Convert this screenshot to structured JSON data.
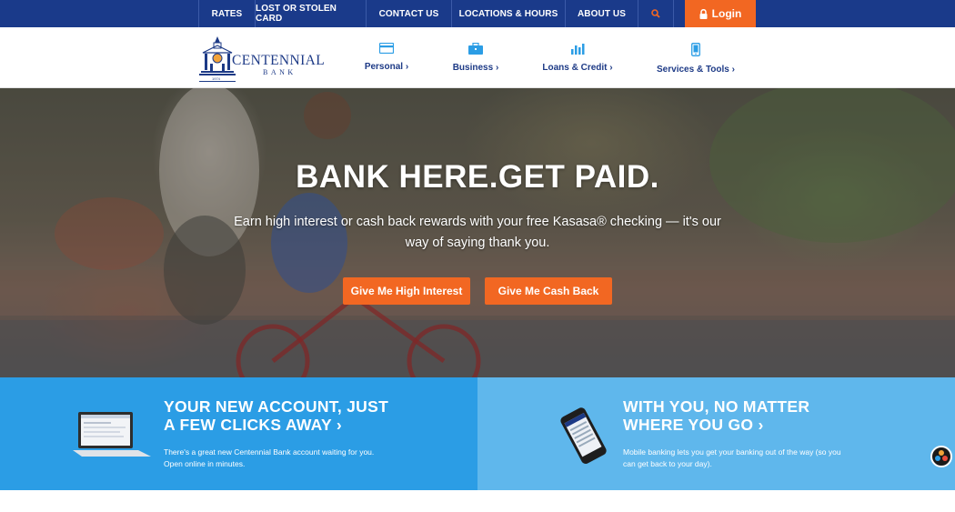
{
  "topbar": {
    "links": [
      "RATES",
      "LOST OR STOLEN CARD",
      "CONTACT US",
      "LOCATIONS & HOURS",
      "ABOUT US"
    ],
    "search_icon": "search-icon",
    "login_label": "Login",
    "login_icon": "lock-icon"
  },
  "logo": {
    "name": "CENTENNIAL",
    "sub": "BANK",
    "year": "1974"
  },
  "nav": {
    "personal": "Personal",
    "business": "Business",
    "loans": "Loans & Credit",
    "services": "Services & Tools",
    "icons": [
      "card-icon",
      "briefcase-icon",
      "bar-chart-icon",
      "mobile-phone-icon"
    ]
  },
  "hero": {
    "title": "BANK HERE.GET PAID.",
    "subtitle": "Earn high interest or cash back rewards with your free Kasasa® checking — it's our way of saying thank you.",
    "cta_interest": "Give Me High Interest",
    "cta_cashback": "Give Me Cash Back"
  },
  "panels": {
    "left": {
      "line1": "YOUR NEW ACCOUNT, JUST",
      "line2": "A FEW CLICKS AWAY",
      "chev": "›",
      "text1": "There's a great new Centennial Bank account waiting for you.",
      "text2": "Open online in minutes."
    },
    "right": {
      "line1": "WITH YOU, NO MATTER",
      "line2": "WHERE YOU GO",
      "chev": "›",
      "text1": "Mobile banking lets you get your banking out of the way (so you",
      "text2": "can get back to your day)."
    }
  },
  "colors": {
    "navy": "#1a3a8a",
    "orange": "#f26722",
    "blue_dark": "#2b9de5",
    "blue_light": "#5fb7ec"
  }
}
